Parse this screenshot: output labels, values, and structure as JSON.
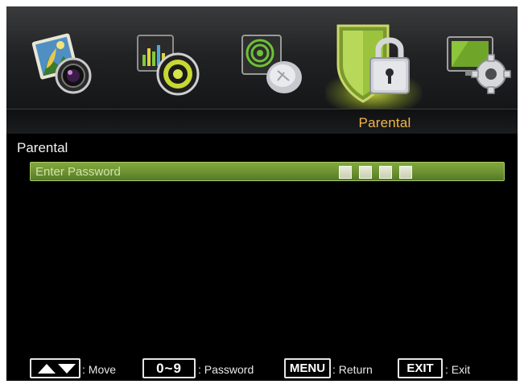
{
  "menu": {
    "items": [
      {
        "id": "picture",
        "icon": "picture-camera-icon",
        "selected": false
      },
      {
        "id": "sound",
        "icon": "sound-speaker-icon",
        "selected": false
      },
      {
        "id": "channel",
        "icon": "satellite-dish-icon",
        "selected": false
      },
      {
        "id": "parental",
        "icon": "shield-lock-icon",
        "selected": true
      },
      {
        "id": "setup",
        "icon": "monitor-gear-icon",
        "selected": false
      }
    ],
    "selected_title": "Parental"
  },
  "page": {
    "heading": "Parental",
    "password_row": {
      "label": "Enter Password",
      "digits_entered": 0,
      "digit_slots": 4
    }
  },
  "hints": {
    "move_key": "▲▼",
    "move_label": ": Move",
    "digits_key": "0~9",
    "digits_label": ": Password",
    "menu_key": "MENU",
    "menu_label": ": Return",
    "exit_key": "EXIT",
    "exit_label": ": Exit"
  },
  "colors": {
    "accent_title": "#f2b64a",
    "highlight_row": "#6b9132",
    "selection_glow": "#d6e63c"
  }
}
